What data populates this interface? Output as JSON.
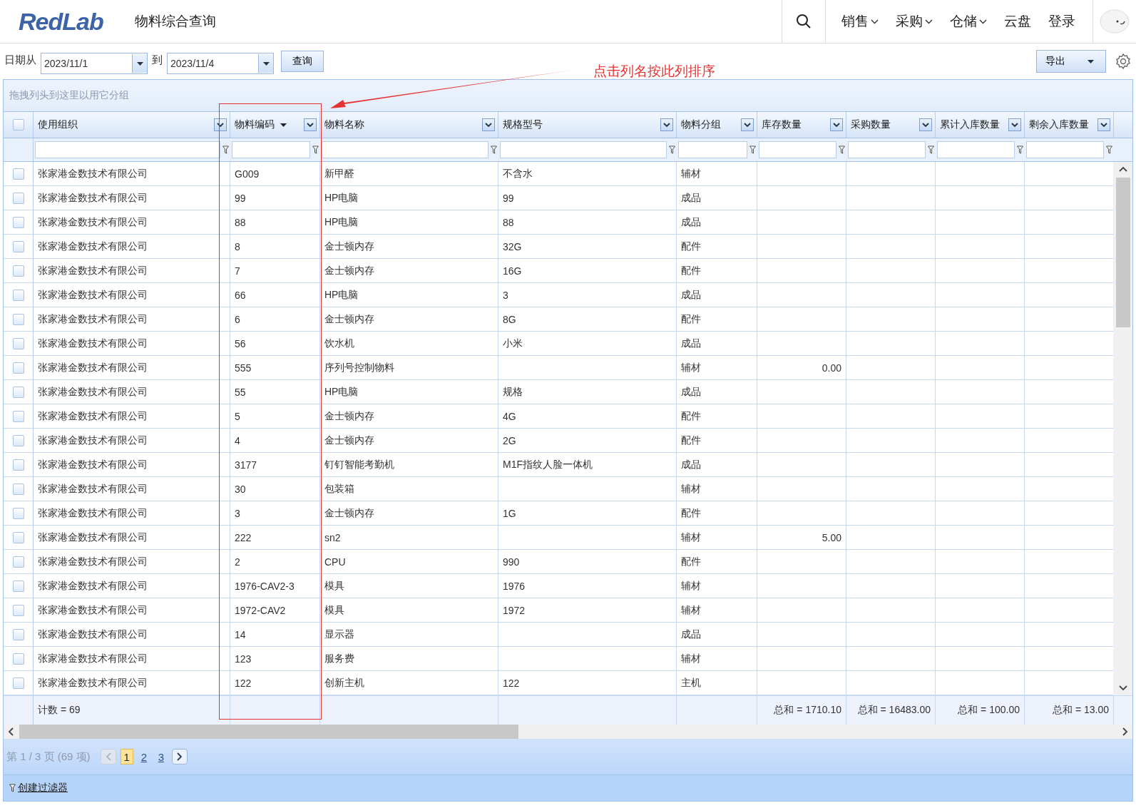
{
  "header": {
    "logo": "RedLab",
    "page_title": "物料综合查询",
    "nav": [
      {
        "label": "销售",
        "kind": "menu"
      },
      {
        "label": "采购",
        "kind": "menu"
      },
      {
        "label": "仓储",
        "kind": "menu"
      },
      {
        "label": "云盘",
        "kind": "link"
      },
      {
        "label": "登录",
        "kind": "link"
      }
    ]
  },
  "toolbar": {
    "date_from_label": "日期从",
    "date_from": "2023/11/1",
    "date_to_label": "到",
    "date_to": "2023/11/4",
    "query_button": "查询",
    "export_button": "导出"
  },
  "annotation": {
    "text": "点击列名按此列排序"
  },
  "group_panel": {
    "hint": "拖拽列头到这里以用它分组"
  },
  "grid": {
    "select_all_checked": false,
    "columns": [
      {
        "label": "使用组织",
        "sorted": false
      },
      {
        "label": "物料编码",
        "sorted": true
      },
      {
        "label": "物料名称",
        "sorted": false
      },
      {
        "label": "规格型号",
        "sorted": false
      },
      {
        "label": "物料分组",
        "sorted": false
      },
      {
        "label": "库存数量",
        "sorted": false
      },
      {
        "label": "采购数量",
        "sorted": false
      },
      {
        "label": "累计入库数量",
        "sorted": false
      },
      {
        "label": "剩余入库数量",
        "sorted": false
      }
    ],
    "rows": [
      {
        "checked": false,
        "org": "张家港金数技术有限公司",
        "code": "G009",
        "name": "新甲醛",
        "spec": "不含水",
        "group": "辅材"
      },
      {
        "checked": false,
        "org": "张家港金数技术有限公司",
        "code": "99",
        "name": "HP电脑",
        "spec": "99",
        "group": "成品"
      },
      {
        "checked": false,
        "org": "张家港金数技术有限公司",
        "code": "88",
        "name": "HP电脑",
        "spec": "88",
        "group": "成品"
      },
      {
        "checked": false,
        "org": "张家港金数技术有限公司",
        "code": "8",
        "name": "金士顿内存",
        "spec": "32G",
        "group": "配件"
      },
      {
        "checked": false,
        "org": "张家港金数技术有限公司",
        "code": "7",
        "name": "金士顿内存",
        "spec": "16G",
        "group": "配件"
      },
      {
        "checked": false,
        "org": "张家港金数技术有限公司",
        "code": "66",
        "name": "HP电脑",
        "spec": "3",
        "group": "成品"
      },
      {
        "checked": false,
        "org": "张家港金数技术有限公司",
        "code": "6",
        "name": "金士顿内存",
        "spec": "8G",
        "group": "配件"
      },
      {
        "checked": false,
        "org": "张家港金数技术有限公司",
        "code": "56",
        "name": "饮水机",
        "spec": "小米",
        "group": "成品"
      },
      {
        "checked": false,
        "org": "张家港金数技术有限公司",
        "code": "555",
        "name": "序列号控制物料",
        "group": "辅材",
        "stock": "0.00"
      },
      {
        "checked": false,
        "org": "张家港金数技术有限公司",
        "code": "55",
        "name": "HP电脑",
        "spec": "规格",
        "group": "成品"
      },
      {
        "checked": false,
        "org": "张家港金数技术有限公司",
        "code": "5",
        "name": "金士顿内存",
        "spec": "4G",
        "group": "配件"
      },
      {
        "checked": false,
        "org": "张家港金数技术有限公司",
        "code": "4",
        "name": "金士顿内存",
        "spec": "2G",
        "group": "配件"
      },
      {
        "checked": false,
        "org": "张家港金数技术有限公司",
        "code": "3177",
        "name": "钉钉智能考勤机",
        "spec": "M1F指纹人脸一体机",
        "group": "成品"
      },
      {
        "checked": false,
        "org": "张家港金数技术有限公司",
        "code": "30",
        "name": "包装箱",
        "group": "辅材"
      },
      {
        "checked": false,
        "org": "张家港金数技术有限公司",
        "code": "3",
        "name": "金士顿内存",
        "spec": "1G",
        "group": "配件"
      },
      {
        "checked": false,
        "org": "张家港金数技术有限公司",
        "code": "222",
        "name": "sn2",
        "group": "辅材",
        "stock": "5.00"
      },
      {
        "checked": false,
        "org": "张家港金数技术有限公司",
        "code": "2",
        "name": "CPU",
        "spec": "990",
        "group": "配件"
      },
      {
        "checked": false,
        "org": "张家港金数技术有限公司",
        "code": "1976-CAV2-3",
        "name": "模具",
        "spec": "1976",
        "group": "辅材"
      },
      {
        "checked": false,
        "org": "张家港金数技术有限公司",
        "code": "1972-CAV2",
        "name": "模具",
        "spec": "1972",
        "group": "辅材"
      },
      {
        "checked": false,
        "org": "张家港金数技术有限公司",
        "code": "14",
        "name": "显示器",
        "group": "成品"
      },
      {
        "checked": false,
        "org": "张家港金数技术有限公司",
        "code": "123",
        "name": "服务费",
        "group": "辅材"
      },
      {
        "checked": false,
        "org": "张家港金数技术有限公司",
        "code": "122",
        "name": "创新主机",
        "spec": "122",
        "group": "主机"
      }
    ],
    "footer": {
      "org": "计数 = 69",
      "stock": "总和 = 1710.10",
      "purchase": "总和 = 16483.00",
      "received": "总和 = 100.00",
      "remaining": "总和 = 13.00"
    }
  },
  "pager": {
    "info": "第 1 / 3 页 (69 项)",
    "pages": [
      {
        "label": "1",
        "selected": true
      },
      {
        "label": "2",
        "selected": false
      },
      {
        "label": "3",
        "selected": false
      }
    ]
  },
  "filter_bar": {
    "link": "创建过滤器"
  }
}
